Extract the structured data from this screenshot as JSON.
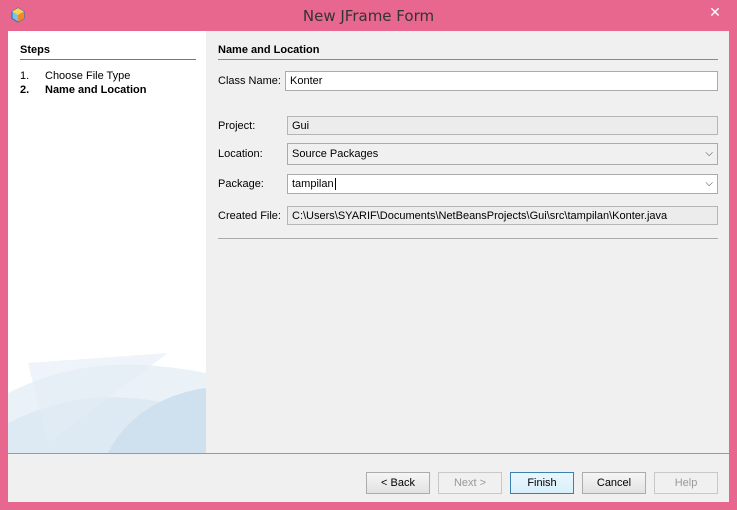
{
  "window": {
    "title": "New JFrame Form",
    "close_glyph": "✕"
  },
  "steps": {
    "title": "Steps",
    "items": [
      {
        "number": "1.",
        "label": "Choose File Type"
      },
      {
        "number": "2.",
        "label": "Name and Location"
      }
    ]
  },
  "form": {
    "section_title": "Name and Location",
    "class_name": {
      "label": "Class Name:",
      "value": "Konter"
    },
    "project": {
      "label": "Project:",
      "value": "Gui"
    },
    "location": {
      "label": "Location:",
      "value": "Source Packages"
    },
    "package": {
      "label": "Package:",
      "value": "tampilan"
    },
    "created_file": {
      "label": "Created File:",
      "value": "C:\\Users\\SYARIF\\Documents\\NetBeansProjects\\Gui\\src\\tampilan\\Konter.java"
    }
  },
  "buttons": {
    "back": "< Back",
    "next": "Next >",
    "finish": "Finish",
    "cancel": "Cancel",
    "help": "Help"
  },
  "icons": {
    "app": "netbeans-cube-icon",
    "dropdown": "chevron-down-icon"
  },
  "colors": {
    "frame": "#e8678f",
    "client": "#f0f0f0",
    "default_button": "#3c7fb1"
  }
}
